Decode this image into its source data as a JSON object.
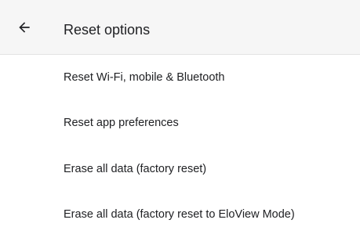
{
  "header": {
    "back_icon": "arrow-left-icon",
    "title": "Reset options"
  },
  "options": [
    {
      "label": "Reset Wi-Fi, mobile & Bluetooth"
    },
    {
      "label": "Reset app preferences"
    },
    {
      "label": "Erase all data (factory reset)"
    },
    {
      "label": "Erase all data (factory reset to EloView Mode)"
    }
  ],
  "colors": {
    "toolbar_bg": "#f6f6f6",
    "text": "#202124",
    "background": "#ffffff"
  }
}
